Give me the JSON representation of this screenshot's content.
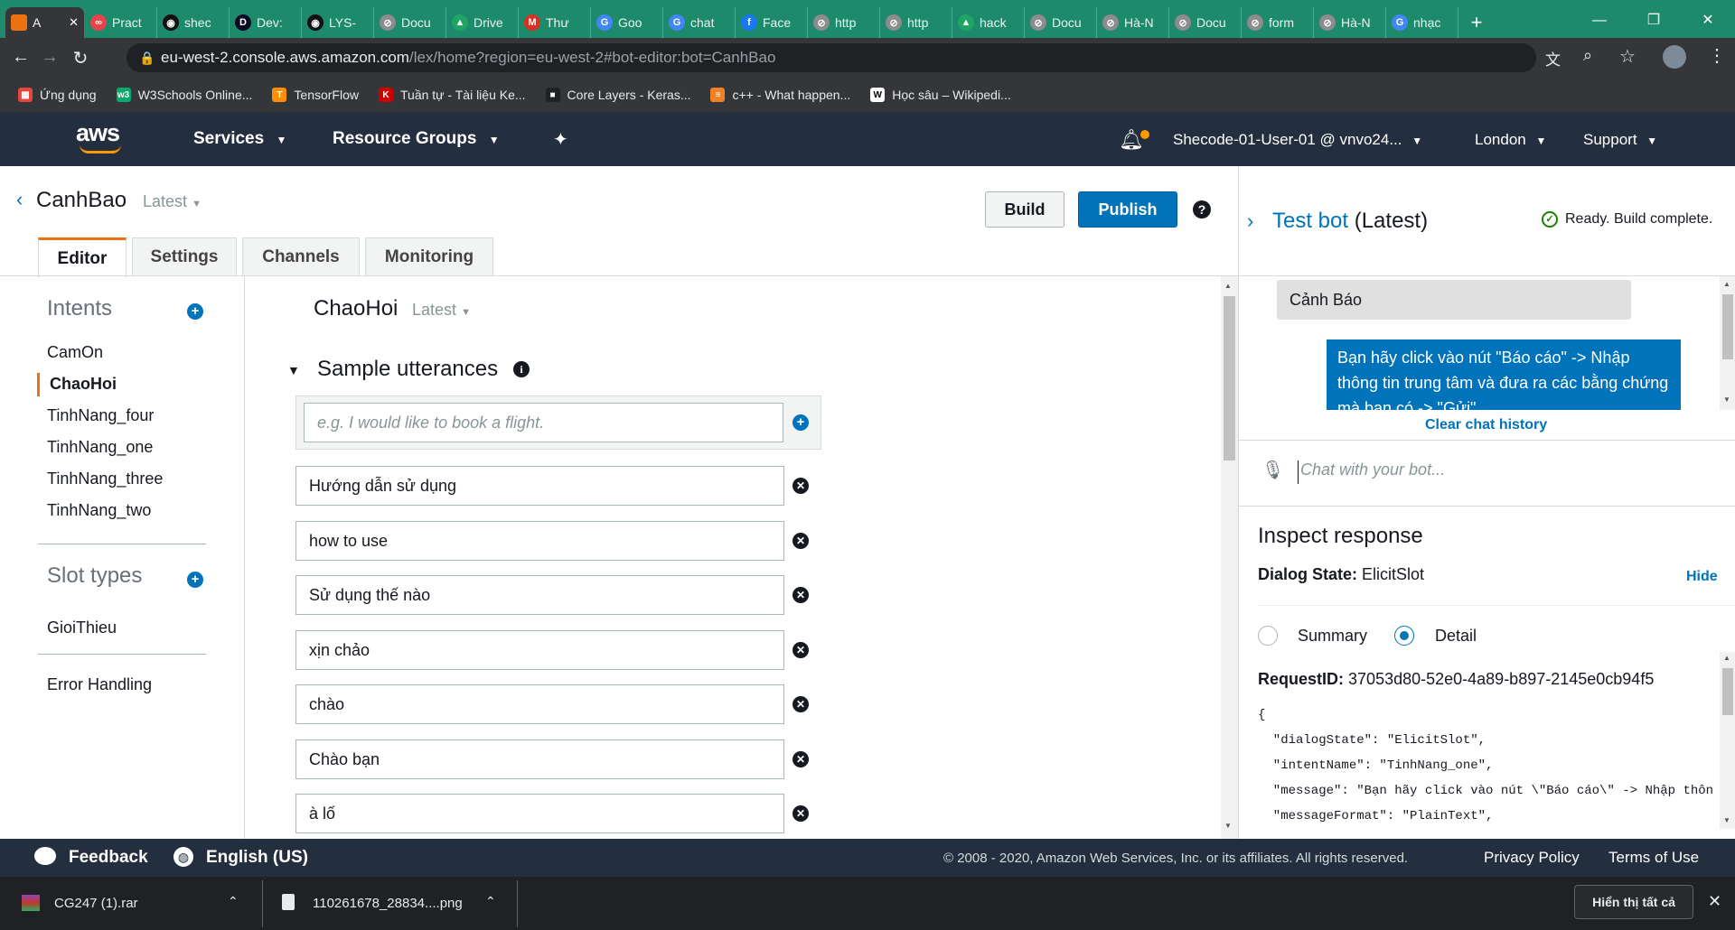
{
  "browser": {
    "tabs": [
      {
        "label": "A",
        "fav_color": "#ec7211",
        "fav_glyph": ""
      },
      {
        "label": "Pract",
        "fav_color": "#e8424a",
        "fav_glyph": "∞"
      },
      {
        "label": "shec",
        "fav_color": "#111111",
        "fav_glyph": "◉"
      },
      {
        "label": "Dev:",
        "fav_color": "#0a0a23",
        "fav_glyph": "D"
      },
      {
        "label": "LYS-",
        "fav_color": "#111111",
        "fav_glyph": "◉"
      },
      {
        "label": "Docu",
        "fav_color": "#8c8c8c",
        "fav_glyph": "⊘"
      },
      {
        "label": "Drive",
        "fav_color": "#1fa463",
        "fav_glyph": "▲"
      },
      {
        "label": "Thư",
        "fav_color": "#d93025",
        "fav_glyph": "M"
      },
      {
        "label": "Goo",
        "fav_color": "#4285f4",
        "fav_glyph": "G"
      },
      {
        "label": "chat",
        "fav_color": "#4285f4",
        "fav_glyph": "G"
      },
      {
        "label": "Face",
        "fav_color": "#1877f2",
        "fav_glyph": "f"
      },
      {
        "label": "http",
        "fav_color": "#8c8c8c",
        "fav_glyph": "⊘"
      },
      {
        "label": "http",
        "fav_color": "#8c8c8c",
        "fav_glyph": "⊘"
      },
      {
        "label": "hack",
        "fav_color": "#1fa463",
        "fav_glyph": "▲"
      },
      {
        "label": "Docu",
        "fav_color": "#8c8c8c",
        "fav_glyph": "⊘"
      },
      {
        "label": "Hà-N",
        "fav_color": "#8c8c8c",
        "fav_glyph": "⊘"
      },
      {
        "label": "Docu",
        "fav_color": "#8c8c8c",
        "fav_glyph": "⊘"
      },
      {
        "label": "form",
        "fav_color": "#8c8c8c",
        "fav_glyph": "⊘"
      },
      {
        "label": "Hà-N",
        "fav_color": "#8c8c8c",
        "fav_glyph": "⊘"
      },
      {
        "label": "nhạc",
        "fav_color": "#4285f4",
        "fav_glyph": "G"
      }
    ],
    "url_host": "eu-west-2.console.aws.amazon.com",
    "url_path": "/lex/home?region=eu-west-2#bot-editor:bot=CanhBao",
    "bookmarks": [
      {
        "label": "Ứng dụng",
        "color": "#e8453c",
        "glyph": "▦"
      },
      {
        "label": "W3Schools Online...",
        "color": "#04aa6d",
        "glyph": "w3"
      },
      {
        "label": "TensorFlow",
        "color": "#ff8f00",
        "glyph": "T"
      },
      {
        "label": "Tuần tự - Tài liệu Ke...",
        "color": "#d00000",
        "glyph": "K"
      },
      {
        "label": "Core Layers - Keras...",
        "color": "#202124",
        "glyph": "■"
      },
      {
        "label": "c++ - What happen...",
        "color": "#f48024",
        "glyph": "≡"
      },
      {
        "label": "Học sâu – Wikipedi...",
        "color": "#ffffff",
        "glyph": "W"
      }
    ]
  },
  "aws": {
    "logo": "aws",
    "services": "Services",
    "resource_groups": "Resource Groups",
    "account": "Shecode-01-User-01 @ vnvo24...",
    "region": "London",
    "support": "Support"
  },
  "bot": {
    "name": "CanhBao",
    "version": "Latest",
    "build": "Build",
    "publish": "Publish",
    "help": "?",
    "tabs": [
      "Editor",
      "Settings",
      "Channels",
      "Monitoring"
    ]
  },
  "sidebar": {
    "intents_title": "Intents",
    "intents": [
      "CamOn",
      "ChaoHoi",
      "TinhNang_four",
      "TinhNang_one",
      "TinhNang_three",
      "TinhNang_two"
    ],
    "slot_types_title": "Slot types",
    "slot_types": [
      "GioiThieu"
    ],
    "error_handling": "Error Handling"
  },
  "editor": {
    "intent_name": "ChaoHoi",
    "intent_version": "Latest",
    "section_title": "Sample utterances",
    "placeholder": "e.g. I would like to book a flight.",
    "utterances": [
      "Hướng dẫn sử dụng",
      "how to use",
      "Sử dụng thế nào",
      "xịn chảo",
      "chào",
      "Chào bạn",
      "à lố"
    ]
  },
  "testbot": {
    "title": "Test bot",
    "version": "(Latest)",
    "status": "Ready. Build complete.",
    "user_message": "Cảnh Báo",
    "bot_message": "Bạn hãy click vào nút \"Báo cáo\" -> Nhập thông tin trung tâm và đưa ra các bằng chứng mà bạn có -> \"Gửi\"",
    "clear_history": "Clear chat history",
    "chat_placeholder": "Chat with your bot...",
    "inspect_title": "Inspect response",
    "dialog_state_label": "Dialog State:",
    "dialog_state_value": "ElicitSlot",
    "hide": "Hide",
    "summary_label": "Summary",
    "detail_label": "Detail",
    "request_label": "RequestID:",
    "request_id": "37053d80-52e0-4a89-b897-2145e0cb94f5",
    "json_lines": [
      "{",
      "  \"dialogState\": \"ElicitSlot\",",
      "  \"intentName\": \"TinhNang_one\",",
      "  \"message\": \"Bạn hãy click vào nút \\\"Báo cáo\\\" -> Nhập thôn",
      "  \"messageFormat\": \"PlainText\","
    ]
  },
  "footer": {
    "feedback": "Feedback",
    "language": "English (US)",
    "copyright": "© 2008 - 2020, Amazon Web Services, Inc. or its affiliates. All rights reserved.",
    "privacy": "Privacy Policy",
    "terms": "Terms of Use"
  },
  "downloads": {
    "items": [
      "CG247 (1).rar",
      "110261678_28834....png"
    ],
    "show_all": "Hiển thị tất cả"
  },
  "colors": {
    "aws_orange": "#ec7211",
    "aws_blue": "#0073bb",
    "header_bg": "#232f3e",
    "chrome_tab": "#1d8a6b"
  }
}
